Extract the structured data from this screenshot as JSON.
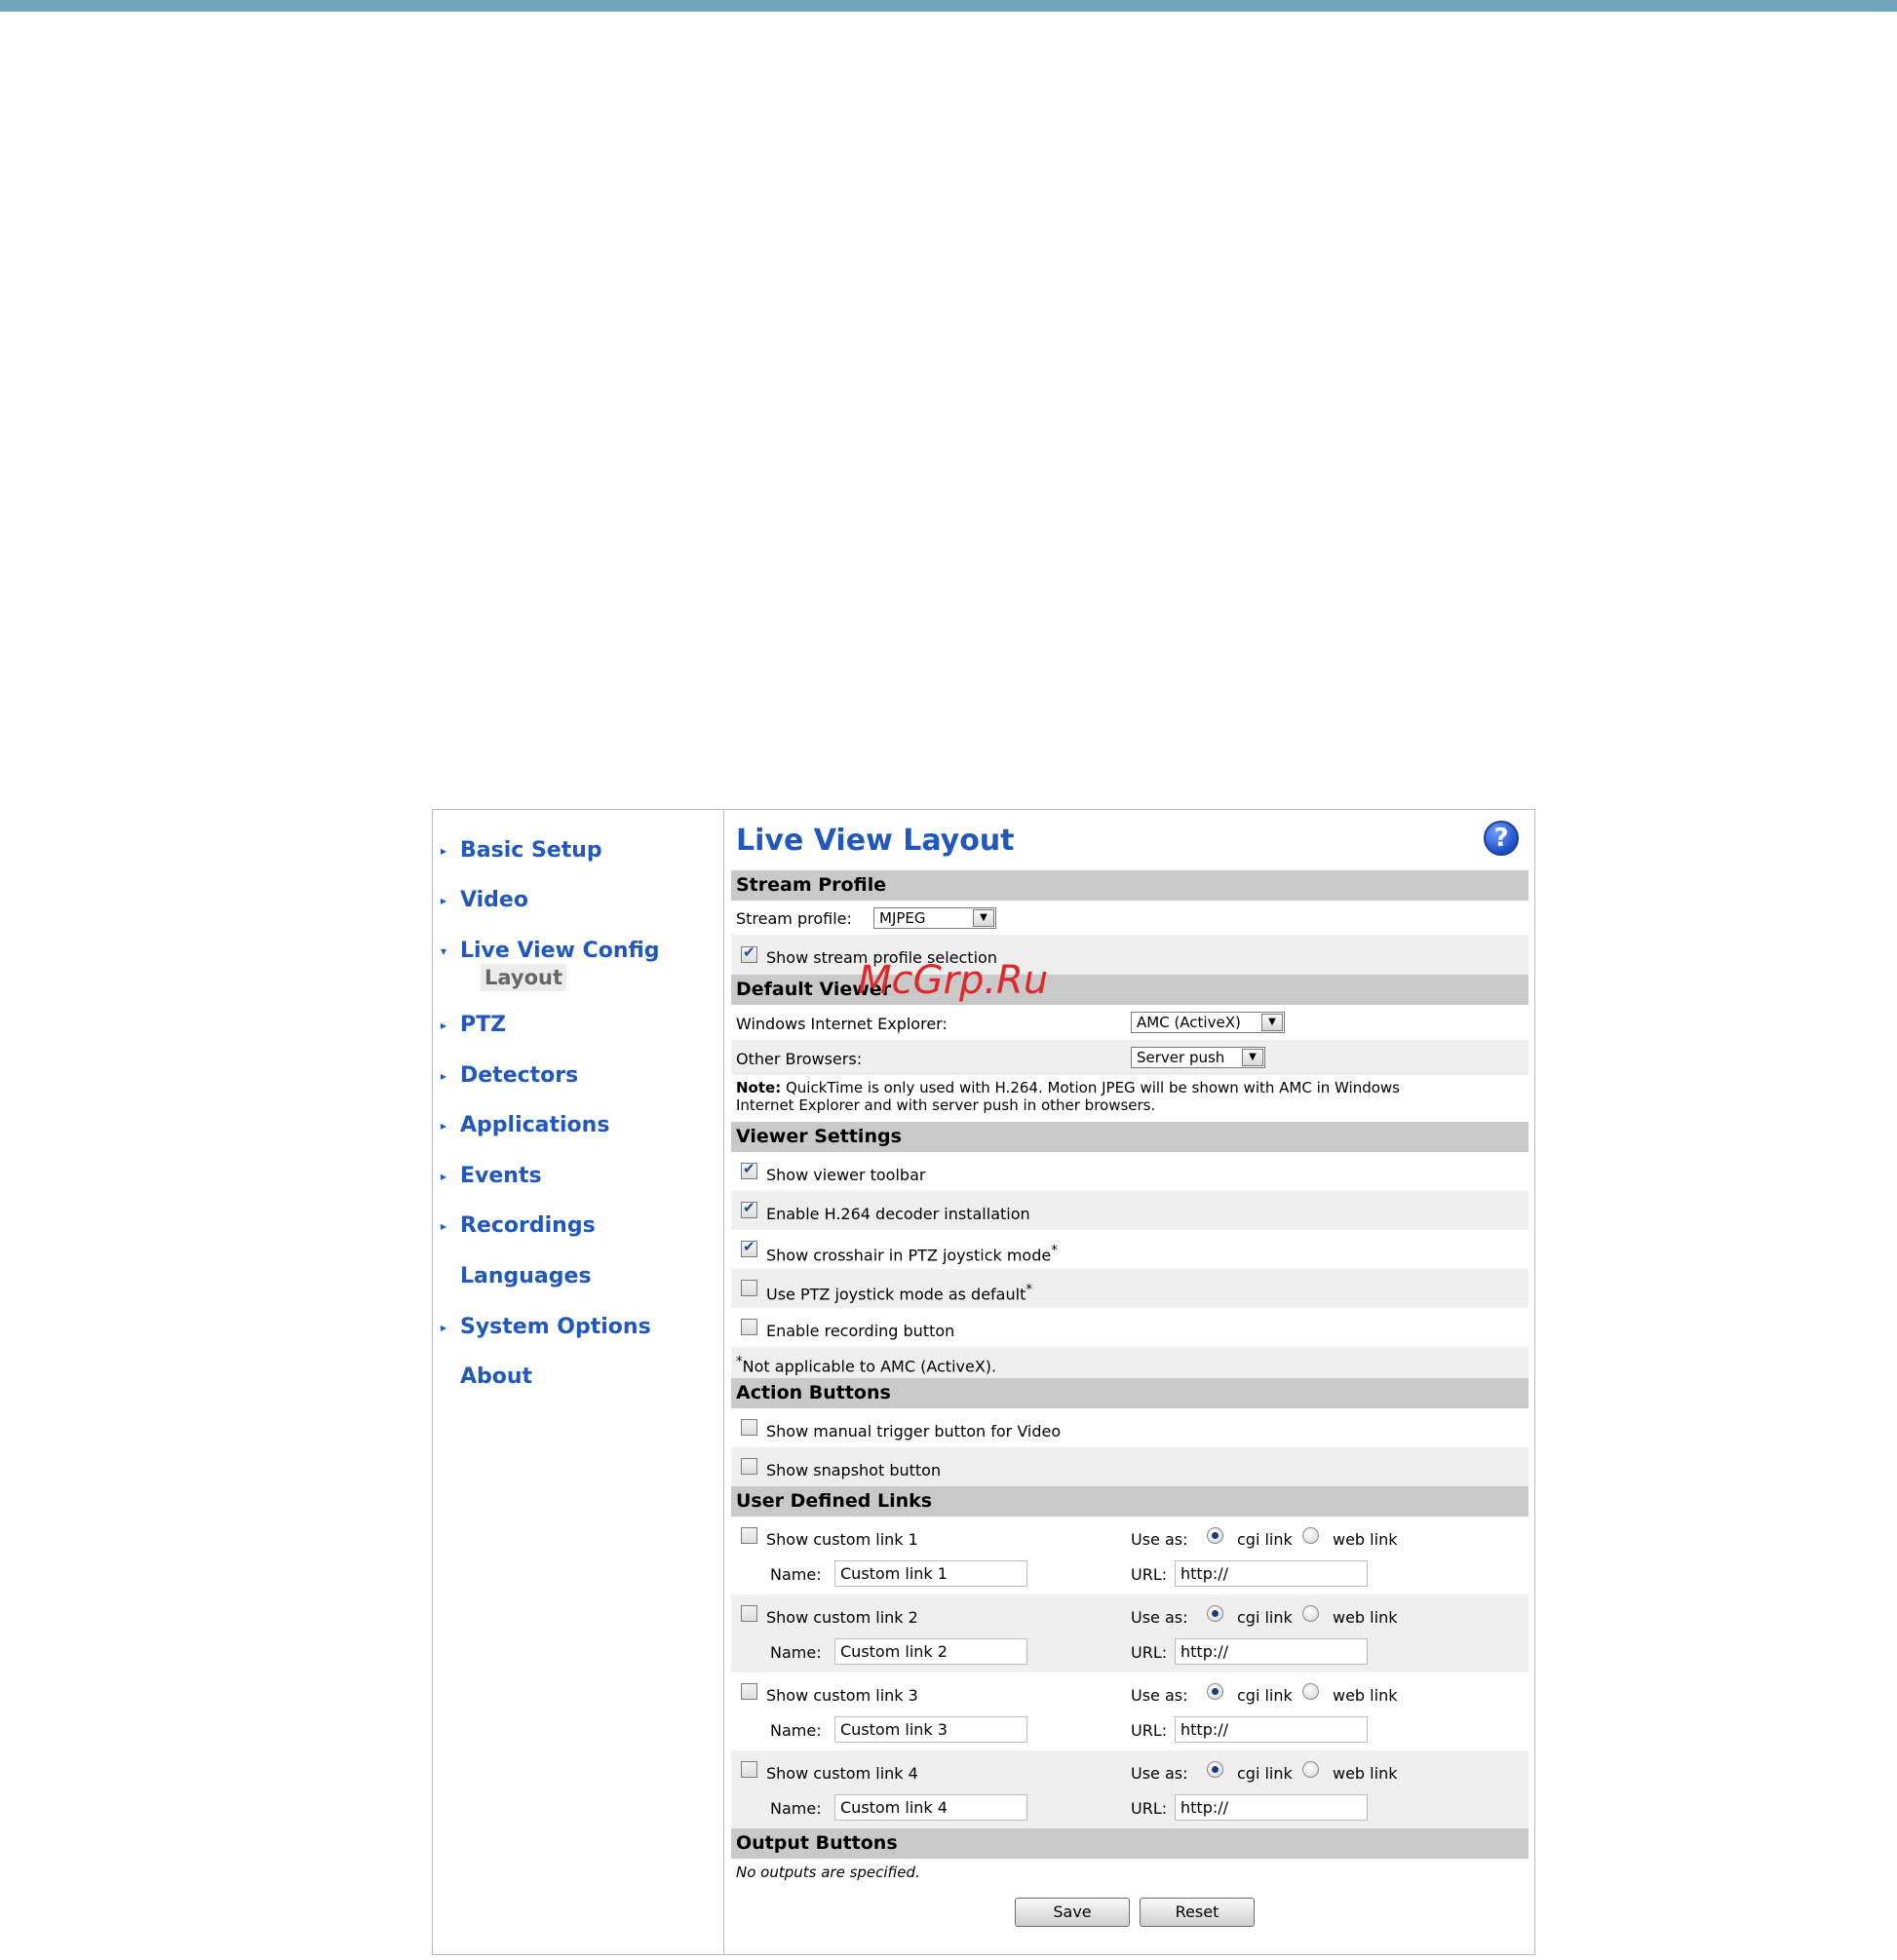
{
  "watermark": "McGrp.Ru",
  "sidebar": {
    "items": [
      {
        "label": "Basic Setup",
        "arrow": "▸"
      },
      {
        "label": "Video",
        "arrow": "▸"
      },
      {
        "label": "Live View Config",
        "arrow": "▾"
      },
      {
        "label": "PTZ",
        "arrow": "▸"
      },
      {
        "label": "Detectors",
        "arrow": "▸"
      },
      {
        "label": "Applications",
        "arrow": "▸"
      },
      {
        "label": "Events",
        "arrow": "▸"
      },
      {
        "label": "Recordings",
        "arrow": "▸"
      },
      {
        "label": "Languages",
        "arrow": ""
      },
      {
        "label": "System Options",
        "arrow": "▸"
      },
      {
        "label": "About",
        "arrow": ""
      }
    ],
    "subitem": "Layout"
  },
  "page": {
    "title": "Live View Layout",
    "help_symbol": "?"
  },
  "stream_profile": {
    "header": "Stream Profile",
    "label": "Stream profile:",
    "value": "MJPEG",
    "show_selection_label": "Show stream profile selection",
    "show_selection_checked": true
  },
  "default_viewer": {
    "header": "Default Viewer",
    "ie_label": "Windows Internet Explorer:",
    "ie_value": "AMC (ActiveX)",
    "other_label": "Other Browsers:",
    "other_value": "Server push",
    "note_bold": "Note:",
    "note_line1": " QuickTime is only used with H.264. Motion JPEG will be shown with AMC in Windows",
    "note_line2": "Internet Explorer and with server push in other browsers."
  },
  "viewer_settings": {
    "header": "Viewer Settings",
    "items": [
      {
        "label": "Show viewer toolbar",
        "sup": "",
        "checked": true
      },
      {
        "label": "Enable H.264 decoder installation",
        "sup": "",
        "checked": true
      },
      {
        "label": "Show crosshair in PTZ joystick mode",
        "sup": "*",
        "checked": true
      },
      {
        "label": "Use PTZ joystick mode as default",
        "sup": "*",
        "checked": false
      },
      {
        "label": "Enable recording button",
        "sup": "",
        "checked": false
      }
    ],
    "footnote_star": "*",
    "footnote": "Not applicable to AMC (ActiveX)."
  },
  "action_buttons": {
    "header": "Action Buttons",
    "items": [
      {
        "label": "Show manual trigger button for Video",
        "checked": false
      },
      {
        "label": "Show snapshot button",
        "checked": false
      }
    ]
  },
  "user_links": {
    "header": "User Defined Links",
    "use_as_label": "Use as:",
    "cgi_label": "cgi link",
    "web_label": "web link",
    "name_label": "Name:",
    "url_label": "URL:",
    "links": [
      {
        "label": "Show custom link 1",
        "name": "Custom link 1",
        "url": "http://",
        "checked": false,
        "mode": "cgi"
      },
      {
        "label": "Show custom link 2",
        "name": "Custom link 2",
        "url": "http://",
        "checked": false,
        "mode": "cgi"
      },
      {
        "label": "Show custom link 3",
        "name": "Custom link 3",
        "url": "http://",
        "checked": false,
        "mode": "cgi"
      },
      {
        "label": "Show custom link 4",
        "name": "Custom link 4",
        "url": "http://",
        "checked": false,
        "mode": "cgi"
      }
    ]
  },
  "output_buttons": {
    "header": "Output Buttons",
    "empty_text": "No outputs are specified."
  },
  "actions": {
    "save_label": "Save",
    "reset_label": "Reset"
  },
  "colors": {
    "accent": "#2058c0",
    "topbar": "#6fa6ba",
    "section_header": "#c9c9c9",
    "row_shade": "#efefef"
  }
}
